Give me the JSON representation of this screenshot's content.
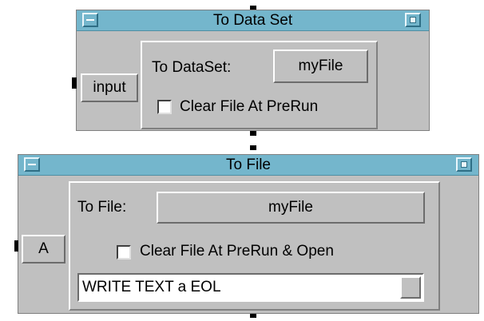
{
  "dataset_object": {
    "title": "To Data Set",
    "input_terminal": "input",
    "to_dataset_label": "To DataSet:",
    "dataset_name": "myFile",
    "clear_label": "Clear File At PreRun"
  },
  "file_object": {
    "title": "To File",
    "input_terminal": "A",
    "to_file_label": "To File:",
    "file_name": "myFile",
    "clear_label": "Clear File At PreRun & Open",
    "transaction": "WRITE TEXT a EOL"
  }
}
